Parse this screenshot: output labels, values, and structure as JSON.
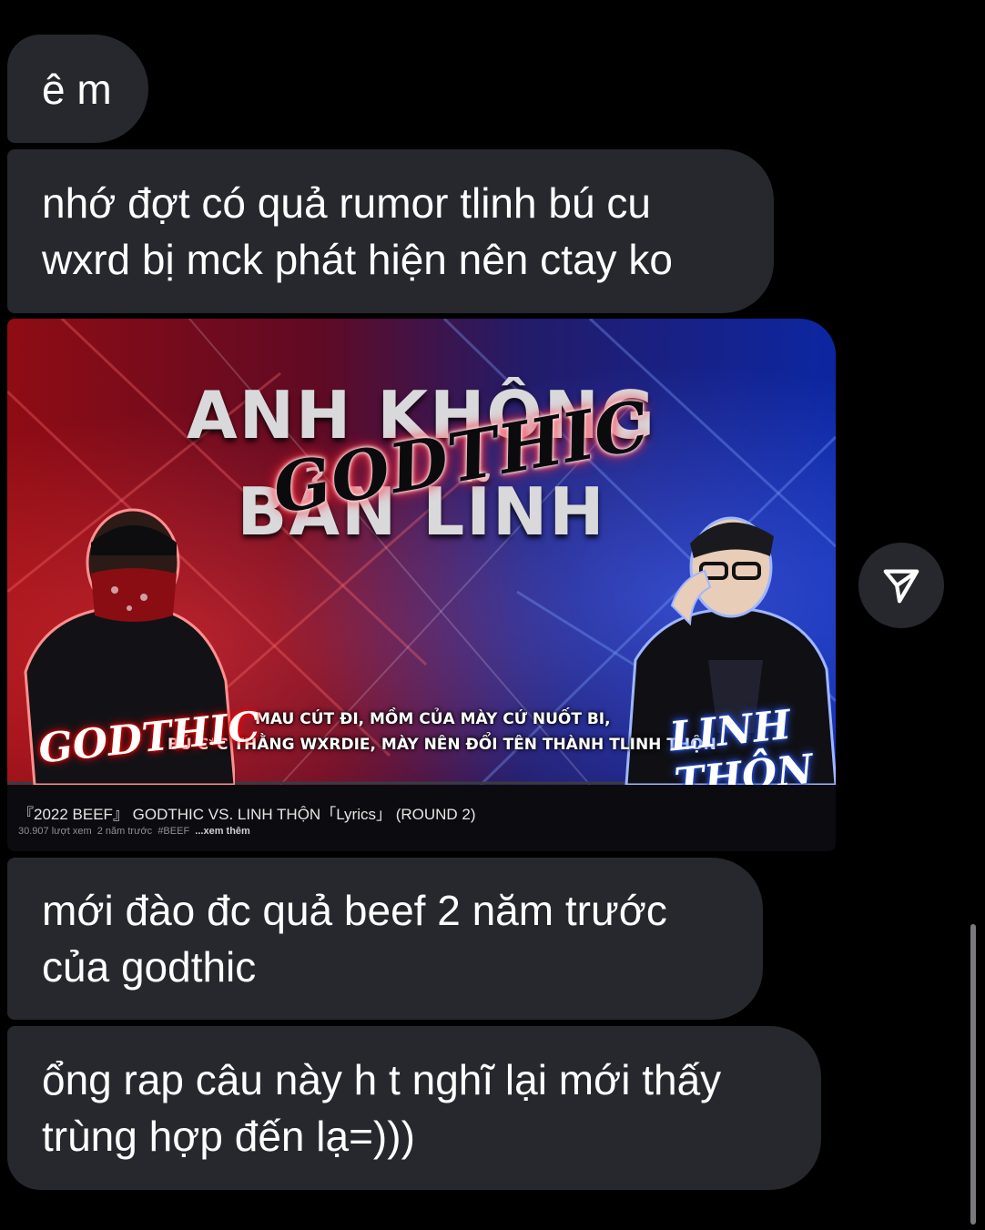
{
  "messages": [
    {
      "lines": [
        "ê m"
      ]
    },
    {
      "lines": [
        "nhớ đợt có quả rumor tlinh bú cu",
        "wxrd bị mck phát hiện nên ctay ko"
      ]
    },
    {
      "lines": [
        "mới đào đc quả beef 2 năm trước",
        "của godthic"
      ]
    },
    {
      "lines": [
        "ổng rap câu này h t nghĩ lại mới thấy",
        "trùng hợp đến lạ=)))"
      ]
    }
  ],
  "shared_video": {
    "thumbnail": {
      "headline_top": "ANH KHÔNG",
      "headline_bottom": "BẢN LĨNH",
      "logo_word": "GODTHIC",
      "name_left": "GODTHIC",
      "name_right": "LINH THỘN",
      "lyric_line_1": "MAU CÚT ĐI, MỒM CỦA MÀY CỨ NUỐT BI,",
      "lyric_line_2": "BÚ C*C THẰNG WXRDIE, MÀY NÊN ĐỔI TÊN THÀNH TLINH THỘN"
    },
    "title": "『2022 BEEF』 GODTHIC VS. LINH THỘN「Lyrics」 (ROUND 2)",
    "views": "30.907 lượt xem",
    "age": "2 năm trước",
    "hashtag": "#BEEF",
    "more_label": "...xem thêm"
  },
  "share_button": {
    "icon": "paper-plane-icon"
  },
  "colors": {
    "background": "#000000",
    "bubble": "#26282d",
    "text": "#ffffff",
    "red_glow": "#ff2a3a",
    "blue_glow": "#2a5cff"
  }
}
